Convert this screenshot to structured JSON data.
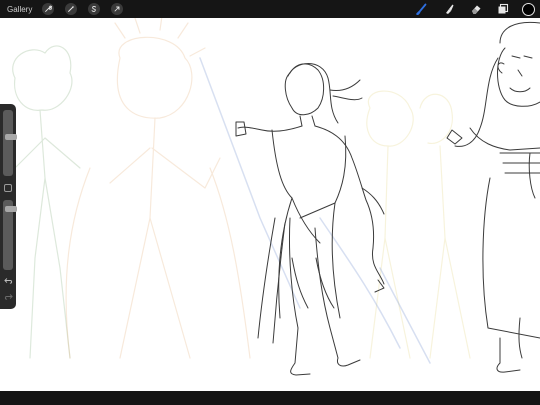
{
  "app": {
    "gallery_label": "Gallery",
    "accent_color": "#2e6fe0",
    "current_color": "#000000"
  },
  "toolbar": {
    "left_tools": [
      {
        "name": "wrench-icon"
      },
      {
        "name": "adjustments-wand-icon"
      },
      {
        "name": "selection-s-icon"
      },
      {
        "name": "transform-arrow-icon"
      }
    ],
    "right_tools": [
      {
        "name": "brush-icon",
        "active": true
      },
      {
        "name": "smudge-icon",
        "active": false
      },
      {
        "name": "eraser-icon",
        "active": false
      },
      {
        "name": "layers-icon",
        "active": false
      }
    ]
  },
  "sidebar": {
    "size_slider_level": 0.6,
    "opacity_slider_level": 0.9,
    "undo_icon": "undo-icon",
    "redo_icon": "redo-icon"
  }
}
